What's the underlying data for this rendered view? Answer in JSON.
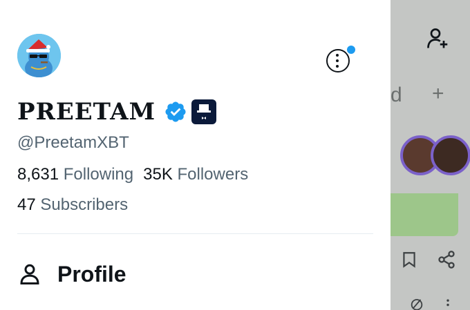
{
  "profile": {
    "display_name": "PREETAM",
    "handle": "@PreetamXBT",
    "following_count": "8,631",
    "following_label": "Following",
    "followers_count": "35K",
    "followers_label": "Followers",
    "subscribers_count": "47",
    "subscribers_label": "Subscribers"
  },
  "menu": {
    "items": [
      {
        "label": "Profile",
        "icon": "person-icon"
      }
    ]
  },
  "background": {
    "partial_text": "d",
    "plus_symbol": "+"
  },
  "colors": {
    "accent": "#1d9bf0",
    "text_primary": "#0f1419",
    "text_secondary": "#536471",
    "overlay": "#c4c6c4"
  }
}
